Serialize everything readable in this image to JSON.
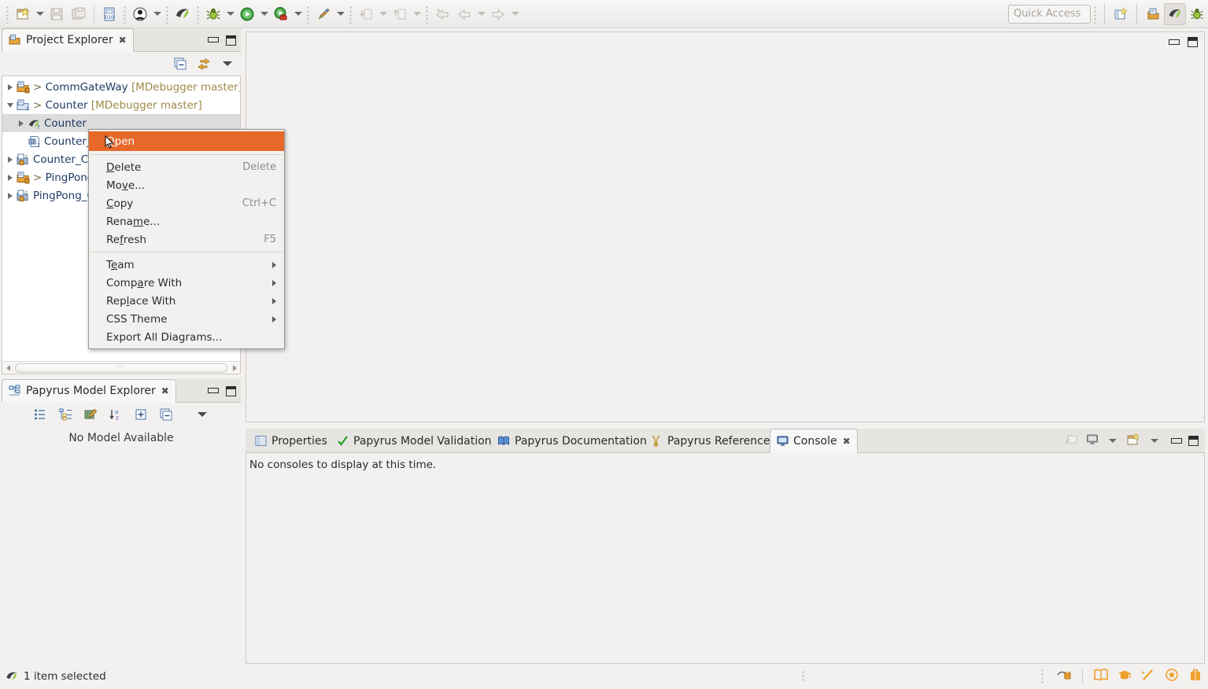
{
  "toolbar": {
    "quick_access_placeholder": "Quick Access",
    "buttons": [
      {
        "name": "new-wizard",
        "icon": "new-file-icon",
        "enabled": true,
        "has_dropdown": true
      },
      {
        "name": "save",
        "icon": "save-icon",
        "enabled": false
      },
      {
        "name": "save-all",
        "icon": "save-all-icon",
        "enabled": false
      },
      {
        "name": "new-model",
        "icon": "new-model-icon",
        "enabled": true
      },
      {
        "name": "user-profile",
        "icon": "person-icon",
        "enabled": true,
        "has_dropdown": true
      },
      {
        "name": "papyrus-perspective",
        "icon": "papyrus-icon",
        "enabled": true
      },
      {
        "name": "debug",
        "icon": "bug-icon",
        "enabled": true,
        "has_dropdown": true
      },
      {
        "name": "run",
        "icon": "run-green-icon",
        "enabled": true,
        "has_dropdown": true
      },
      {
        "name": "run-with-coverage",
        "icon": "run-coverage-icon",
        "enabled": true,
        "has_dropdown": true
      },
      {
        "name": "external-tools",
        "icon": "external-tools-icon",
        "enabled": true,
        "has_dropdown": true
      },
      {
        "name": "step-into",
        "icon": "step-into-icon",
        "enabled": false,
        "has_dropdown": true
      },
      {
        "name": "step-out",
        "icon": "step-out-icon",
        "enabled": false,
        "has_dropdown": true
      },
      {
        "name": "next-annotation",
        "icon": "next-annotation-icon",
        "enabled": false
      },
      {
        "name": "back",
        "icon": "back-arrow-icon",
        "enabled": false,
        "has_dropdown": true
      },
      {
        "name": "forward",
        "icon": "forward-arrow-icon",
        "enabled": false,
        "has_dropdown": true
      }
    ],
    "perspective_buttons": [
      {
        "name": "open-perspective",
        "icon": "open-perspective-icon"
      },
      {
        "name": "java-perspective",
        "icon": "java-perspective-icon"
      },
      {
        "name": "papyrus-perspective-active",
        "icon": "papyrus-perspective-icon",
        "active": true
      },
      {
        "name": "debug-perspective",
        "icon": "debug-perspective-icon"
      }
    ]
  },
  "project_explorer": {
    "title": "Project Explorer",
    "close_glyph": "✖",
    "toolbar": [
      {
        "name": "collapse-all",
        "icon": "collapse-all-icon"
      },
      {
        "name": "link-with-editor",
        "icon": "link-editor-icon"
      },
      {
        "name": "view-menu",
        "icon": "view-menu-icon"
      }
    ],
    "tree": [
      {
        "label": "CommGateWay",
        "prefix": "> ",
        "branch": " [MDebugger master]",
        "indent": 0,
        "twist": "closed",
        "icon": "project-closed-icon",
        "selected": false
      },
      {
        "label": "Counter",
        "prefix": "> ",
        "branch": " [MDebugger master]",
        "indent": 0,
        "twist": "open",
        "icon": "project-open-icon",
        "selected": false
      },
      {
        "label": "Counter",
        "prefix": "",
        "branch": "",
        "indent": 1,
        "twist": "closed",
        "icon": "papyrus-model-icon",
        "selected": true
      },
      {
        "label": "Counter_C",
        "prefix": "",
        "branch": "",
        "indent": 1,
        "twist": "none",
        "icon": "di-file-icon",
        "selected": false
      },
      {
        "label": "Counter_CD",
        "prefix": "",
        "branch": "",
        "indent": 0,
        "twist": "closed",
        "icon": "c-project-icon",
        "selected": false
      },
      {
        "label": "PingPong",
        "prefix": "> ",
        "branch": "",
        "indent": 0,
        "twist": "closed",
        "icon": "project-closed-icon",
        "selected": false
      },
      {
        "label": "PingPong_C",
        "prefix": "",
        "branch": "",
        "indent": 0,
        "twist": "closed",
        "icon": "c-project-icon",
        "selected": false
      }
    ]
  },
  "papyrus_model_explorer": {
    "title": "Papyrus Model Explorer",
    "close_glyph": "✖",
    "empty_message": "No Model Available",
    "toolbar": [
      {
        "name": "show-properties-view",
        "icon": "list-icon"
      },
      {
        "name": "link-with-editor",
        "icon": "link-tree-icon"
      },
      {
        "name": "customize-view",
        "icon": "customize-icon"
      },
      {
        "name": "sort-alphabetically",
        "icon": "sort-az-icon"
      },
      {
        "name": "expand-all",
        "icon": "expand-all-icon"
      },
      {
        "name": "collapse-all",
        "icon": "collapse-all-icon"
      },
      {
        "name": "view-menu",
        "icon": "view-menu-icon"
      }
    ]
  },
  "context_menu": {
    "items": [
      {
        "label": "Open",
        "mnemonic": "O",
        "accel": "",
        "submenu": false,
        "highlighted": true,
        "separator_after": true
      },
      {
        "label": "Delete",
        "mnemonic": "D",
        "accel": "Delete",
        "submenu": false,
        "highlighted": false
      },
      {
        "label": "Move...",
        "mnemonic": "v",
        "accel": "",
        "submenu": false,
        "highlighted": false
      },
      {
        "label": "Copy",
        "mnemonic": "C",
        "accel": "Ctrl+C",
        "submenu": false,
        "highlighted": false
      },
      {
        "label": "Rename...",
        "mnemonic": "m",
        "accel": "",
        "submenu": false,
        "highlighted": false
      },
      {
        "label": "Refresh",
        "mnemonic": "f",
        "accel": "F5",
        "submenu": false,
        "highlighted": false,
        "separator_after": true
      },
      {
        "label": "Team",
        "mnemonic": "e",
        "accel": "",
        "submenu": true,
        "highlighted": false
      },
      {
        "label": "Compare With",
        "mnemonic": "a",
        "accel": "",
        "submenu": true,
        "highlighted": false
      },
      {
        "label": "Replace With",
        "mnemonic": "l",
        "accel": "",
        "submenu": true,
        "highlighted": false
      },
      {
        "label": "CSS Theme",
        "mnemonic": "",
        "accel": "",
        "submenu": true,
        "highlighted": false
      },
      {
        "label": "Export All Diagrams...",
        "mnemonic": "",
        "accel": "",
        "submenu": false,
        "highlighted": false
      }
    ]
  },
  "bottom_panel": {
    "tabs": [
      {
        "label": "Properties",
        "icon": "properties-icon",
        "active": false
      },
      {
        "label": "Papyrus Model Validation",
        "icon": "checkmark-icon",
        "active": false
      },
      {
        "label": "Papyrus Documentation",
        "icon": "book-icon",
        "active": false
      },
      {
        "label": "Papyrus References",
        "icon": "references-icon",
        "active": false
      },
      {
        "label": "Console",
        "icon": "console-icon",
        "active": true
      }
    ],
    "close_glyph": "✖",
    "console_message": "No consoles to display at this time.",
    "toolbar": [
      {
        "name": "clear-console",
        "icon": "clear-console-icon",
        "enabled": false
      },
      {
        "name": "display-selected-console",
        "icon": "display-console-icon",
        "enabled": true,
        "has_dropdown": true
      },
      {
        "name": "open-console",
        "icon": "open-console-icon",
        "enabled": true,
        "has_dropdown": true
      }
    ]
  },
  "status_bar": {
    "message": "1 item selected",
    "icon": "papyrus-icon",
    "right_icons": [
      {
        "name": "sniff-icon"
      },
      {
        "name": "map-icon"
      },
      {
        "name": "graduation-cap-icon"
      },
      {
        "name": "wand-icon"
      },
      {
        "name": "star-badge-icon"
      },
      {
        "name": "briefcase-icon"
      }
    ]
  },
  "colors": {
    "menu_highlight": "#e8682a",
    "tree_selection": "#dcdcdc",
    "tree_text": "#1f3a63",
    "branch_text": "#a08a4a",
    "panel_bg": "#f2f1f0",
    "accent_orange": "#f0962e"
  }
}
